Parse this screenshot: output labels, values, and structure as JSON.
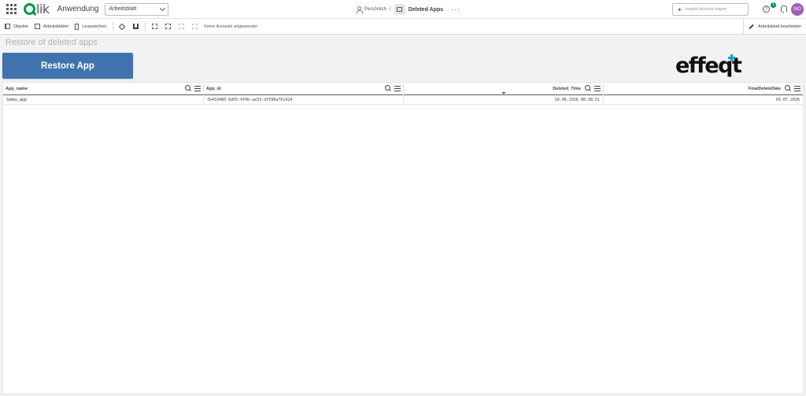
{
  "topbar": {
    "logo_q": "Q",
    "logo_rest": "lik",
    "app_label": "Anwendung",
    "sheet_select": "Arbeitsblatt",
    "crumb_space": "Persönlich",
    "crumb_sep": "/",
    "crumb_app": "Deleted Apps",
    "more": "···",
    "insight_placeholder": "Insight Advisor fragen",
    "help_label": "?",
    "help_badge": "1",
    "avatar_initials": "MO"
  },
  "toolbar": {
    "objects": "Objekte",
    "sheets": "Arbeitsblätter",
    "bookmarks": "Lesezeichen",
    "no_selection": "Keine Auswahl angewendet",
    "edit_sheet": "Arbeitsblatt bearbeiten"
  },
  "sheet": {
    "title": "Restore of deleted apps",
    "nav_prev": "‹",
    "nav_next": "›",
    "restore_button": "Restore App",
    "brand": "effeqt",
    "brand_color": "#00a8c6",
    "button_color": "#3f73ad"
  },
  "table": {
    "columns": [
      "App_name",
      "App_id",
      "Deleted_Time",
      "FinalDeleteDate"
    ],
    "rows": [
      [
        "Sales_app",
        "fb433480-6d55-4f0b-ae55-df598a761424",
        "19.06.2026 08:38:51",
        "03.07.2026"
      ]
    ]
  }
}
